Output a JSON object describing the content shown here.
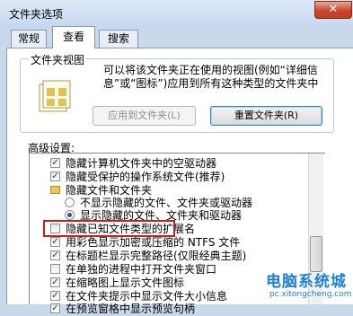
{
  "window": {
    "title": "文件夹选项",
    "close_glyph": "✕"
  },
  "tabs": [
    {
      "label": "常规",
      "active": false
    },
    {
      "label": "查看",
      "active": true
    },
    {
      "label": "搜索",
      "active": false
    }
  ],
  "folder_view": {
    "group_label": "文件夹视图",
    "description": "可以将该文件夹正在使用的视图(例如“详细信息”或“图标”)应用到所有这种类型的文件夹中",
    "apply_button": "应用到文件夹(L)",
    "reset_button": "重置文件夹(R)"
  },
  "advanced": {
    "label": "高级设置:",
    "items": [
      {
        "type": "checkbox",
        "checked": true,
        "label": "隐藏计算机文件夹中的空驱动器"
      },
      {
        "type": "checkbox",
        "checked": true,
        "label": "隐藏受保护的操作系统文件(推荐)"
      },
      {
        "type": "folder",
        "label": "隐藏文件和文件夹"
      },
      {
        "type": "radio",
        "checked": false,
        "label": "不显示隐藏的文件、文件夹或驱动器"
      },
      {
        "type": "radio",
        "checked": true,
        "label": "显示隐藏的文件、文件夹和驱动器"
      },
      {
        "type": "checkbox",
        "checked": false,
        "label": "隐藏已知文件类型的扩展名"
      },
      {
        "type": "checkbox",
        "checked": true,
        "label": "用彩色显示加密或压缩的 NTFS 文件"
      },
      {
        "type": "checkbox",
        "checked": true,
        "label": "在标题栏显示完整路径(仅限经典主题)"
      },
      {
        "type": "checkbox",
        "checked": false,
        "label": "在单独的进程中打开文件夹窗口"
      },
      {
        "type": "checkbox",
        "checked": true,
        "label": "在缩略图上显示文件图标"
      },
      {
        "type": "checkbox",
        "checked": true,
        "label": "在文件夹提示中显示文件大小信息"
      },
      {
        "type": "checkbox",
        "checked": true,
        "label": "在预览窗格中显示预览句柄"
      }
    ]
  },
  "watermark": {
    "brand": "电脑系统城",
    "url": "pc.xitongcheng.com"
  },
  "colors": {
    "highlight": "#c81e1e",
    "window_bg": "#c9d9ec",
    "watermark": "#1e7fd6"
  }
}
